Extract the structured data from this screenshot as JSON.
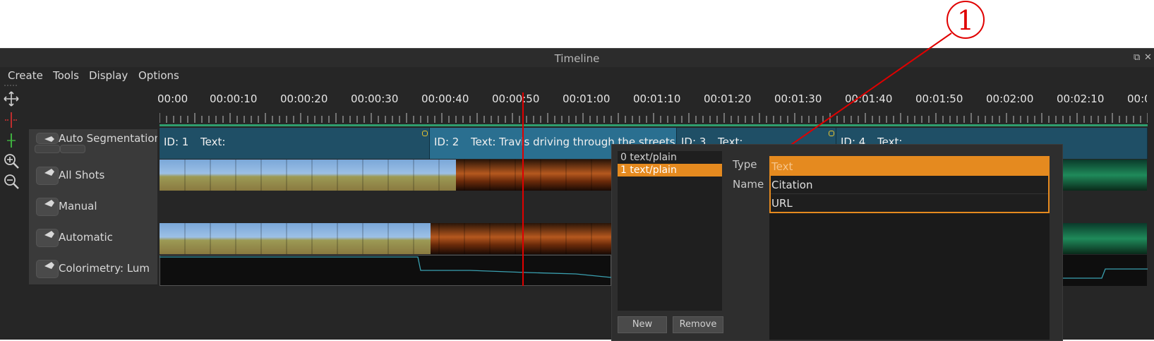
{
  "window": {
    "title": "Timeline",
    "float_glyph": "⧉",
    "close_glyph": "✕"
  },
  "menubar": {
    "items": [
      "Create",
      "Tools",
      "Display",
      "Options"
    ]
  },
  "toolbar": {
    "icons": [
      "move-icon",
      "split-icon",
      "add-marker-icon",
      "zoom-in-icon",
      "zoom-out-icon"
    ]
  },
  "ruler": {
    "labels": [
      "00:00",
      "00:00:10",
      "00:00:20",
      "00:00:30",
      "00:00:40",
      "00:00:50",
      "00:01:00",
      "00:01:10",
      "00:01:20",
      "00:01:30",
      "00:01:40",
      "00:01:50",
      "00:02:00",
      "00:02:10",
      "00:0"
    ]
  },
  "tracks": [
    {
      "label": "Auto Segmentation"
    },
    {
      "label": "All Shots"
    },
    {
      "label": "Manual"
    },
    {
      "label": "Automatic"
    },
    {
      "label": "Colorimetry: Lum"
    }
  ],
  "segments": [
    {
      "id_label": "ID: 1",
      "text": "Text:"
    },
    {
      "id_label": "ID: 2",
      "text": "Text: Travis driving through the streets"
    },
    {
      "id_label": "ID: 3",
      "text": "Text:"
    },
    {
      "id_label": "ID: 4",
      "text": "Text:"
    }
  ],
  "popup": {
    "list_items": [
      "0 text/plain",
      "1 text/plain"
    ],
    "selected_index": 1,
    "new_button": "New",
    "remove_button": "Remove",
    "type_label": "Type",
    "name_label": "Name",
    "type_options": [
      "Text",
      "Citation",
      "URL"
    ]
  },
  "annotation": {
    "number": "1"
  },
  "colors": {
    "accent": "#e58a1f",
    "playhead": "#e00000",
    "segment": "#1f4f66",
    "segment_active": "#2a6f90",
    "annotation": "#e00000",
    "curve": "#3aa0b0"
  }
}
